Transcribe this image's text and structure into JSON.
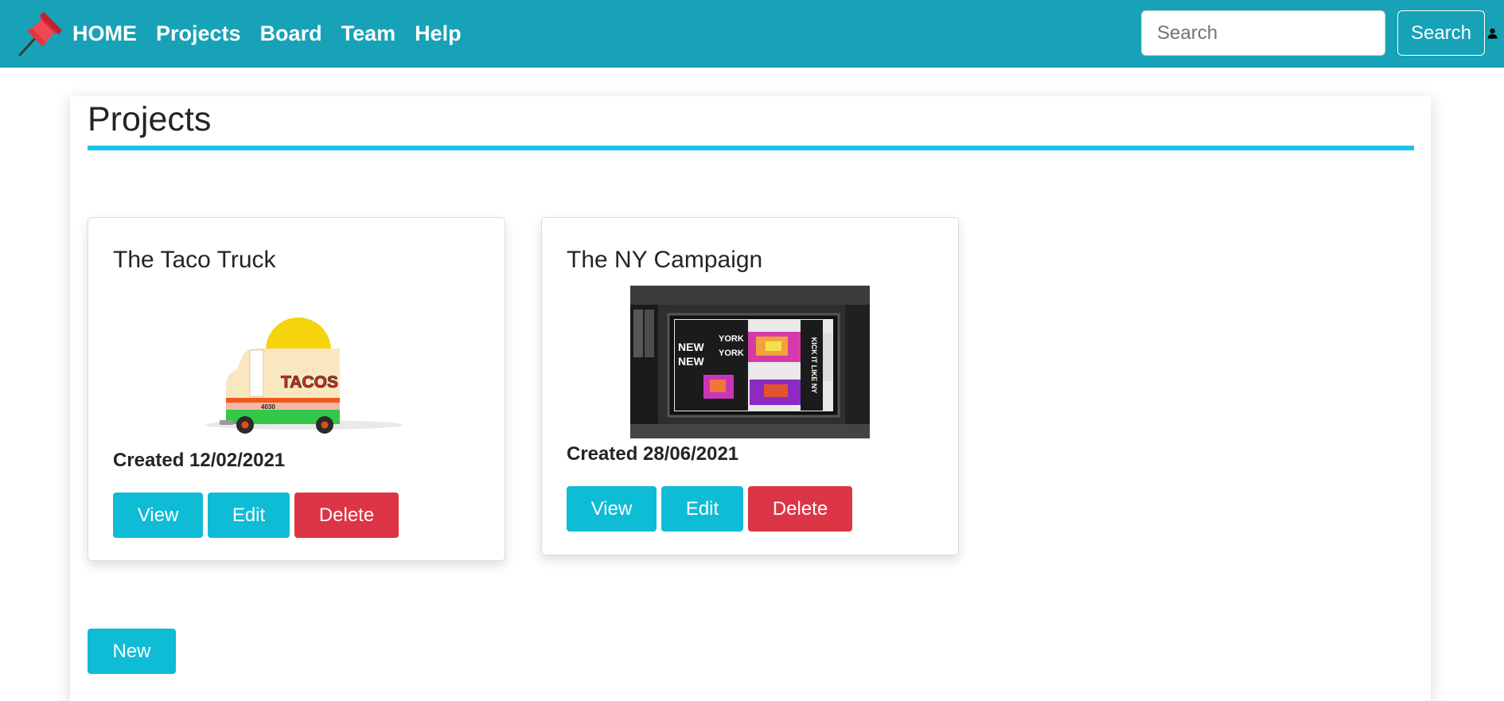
{
  "nav": {
    "links": [
      "HOME",
      "Projects",
      "Board",
      "Team",
      "Help"
    ],
    "search_placeholder": "Search",
    "search_button": "Search"
  },
  "page": {
    "title": "Projects",
    "new_button": "New"
  },
  "projects": [
    {
      "title": "The Taco Truck",
      "created": "Created 12/02/2021",
      "image_text": "TACOS",
      "image_plate": "4030",
      "view_label": "View",
      "edit_label": "Edit",
      "delete_label": "Delete"
    },
    {
      "title": "The NY Campaign",
      "created": "Created 28/06/2021",
      "poster_lines": [
        "NEW",
        "NEW",
        "YORK",
        "YORK",
        "KICK IT LIKE NY"
      ],
      "view_label": "View",
      "edit_label": "Edit",
      "delete_label": "Delete"
    }
  ],
  "colors": {
    "navbar": "#17a2b8",
    "accent_rule": "#1bc3e6",
    "button_info": "#0fbcd6",
    "button_danger": "#dc3545"
  },
  "icons": {
    "logo": "pushpin-icon",
    "user": "user-icon"
  }
}
